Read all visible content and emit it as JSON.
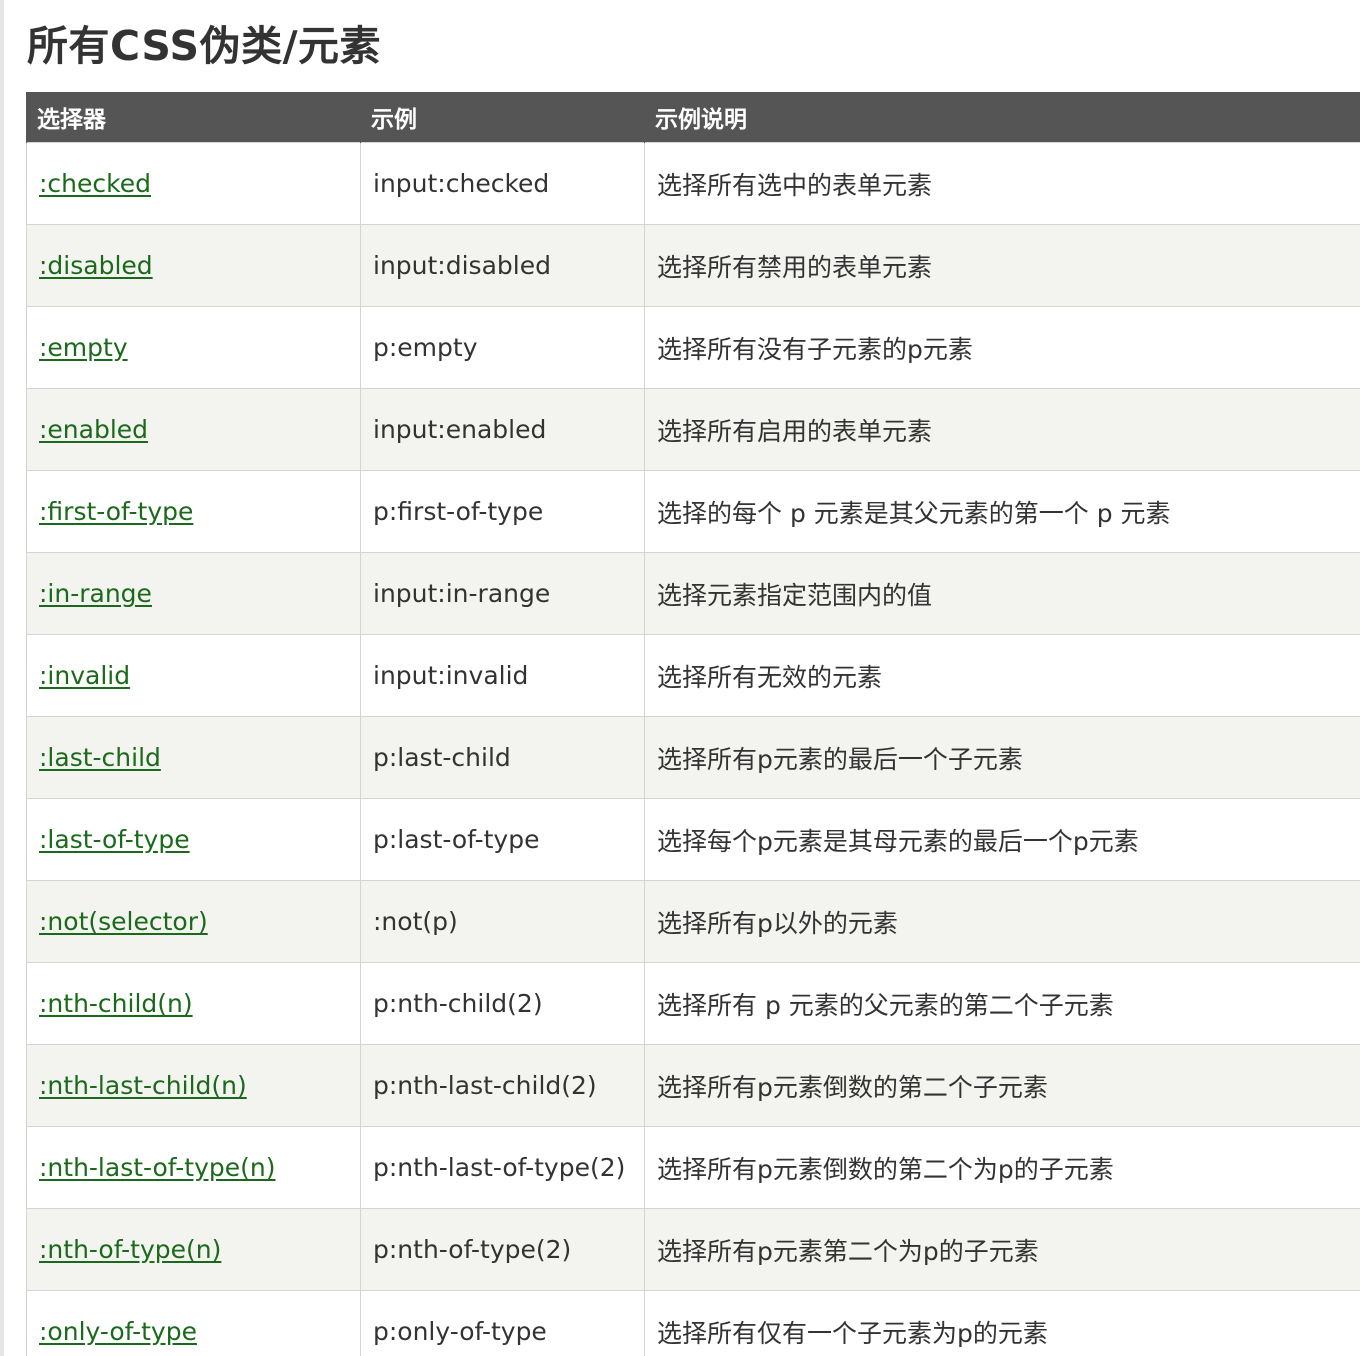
{
  "page": {
    "title": "所有CSS伪类/元素"
  },
  "table": {
    "headers": {
      "selector": "选择器",
      "example": "示例",
      "description": "示例说明"
    },
    "rows": [
      {
        "selector": ":checked",
        "example": "input:checked",
        "description": "选择所有选中的表单元素"
      },
      {
        "selector": ":disabled",
        "example": "input:disabled",
        "description": "选择所有禁用的表单元素"
      },
      {
        "selector": ":empty",
        "example": "p:empty",
        "description": "选择所有没有子元素的p元素"
      },
      {
        "selector": ":enabled",
        "example": "input:enabled",
        "description": "选择所有启用的表单元素"
      },
      {
        "selector": ":first-of-type",
        "example": "p:first-of-type",
        "description": "选择的每个 p 元素是其父元素的第一个 p 元素"
      },
      {
        "selector": ":in-range",
        "example": "input:in-range",
        "description": "选择元素指定范围内的值"
      },
      {
        "selector": ":invalid",
        "example": "input:invalid",
        "description": "选择所有无效的元素"
      },
      {
        "selector": ":last-child",
        "example": "p:last-child",
        "description": "选择所有p元素的最后一个子元素"
      },
      {
        "selector": ":last-of-type",
        "example": "p:last-of-type",
        "description": "选择每个p元素是其母元素的最后一个p元素"
      },
      {
        "selector": ":not(selector)",
        "example": ":not(p)",
        "description": "选择所有p以外的元素"
      },
      {
        "selector": ":nth-child(n)",
        "example": "p:nth-child(2)",
        "description": "选择所有 p 元素的父元素的第二个子元素"
      },
      {
        "selector": ":nth-last-child(n)",
        "example": "p:nth-last-child(2)",
        "description": "选择所有p元素倒数的第二个子元素"
      },
      {
        "selector": ":nth-last-of-type(n)",
        "example": "p:nth-last-of-type(2)",
        "description": "选择所有p元素倒数的第二个为p的子元素"
      },
      {
        "selector": ":nth-of-type(n)",
        "example": "p:nth-of-type(2)",
        "description": "选择所有p元素第二个为p的子元素"
      },
      {
        "selector": ":only-of-type",
        "example": "p:only-of-type",
        "description": "选择所有仅有一个子元素为p的元素"
      }
    ]
  },
  "colors": {
    "header_bg": "#555555",
    "header_text": "#ffffff",
    "link": "#1b6a1b",
    "row_alt_bg": "#f3f3f0",
    "border": "#d4d4d4"
  }
}
